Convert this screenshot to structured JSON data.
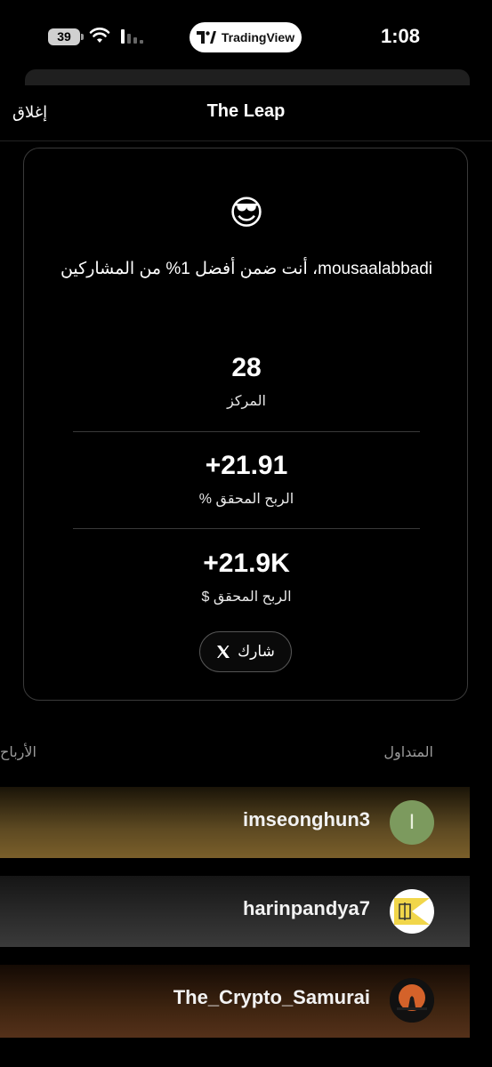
{
  "status_bar": {
    "battery": "39",
    "app_pill": "TradingView",
    "time": "1:08"
  },
  "header": {
    "close": "إغلاق",
    "title": "The Leap"
  },
  "card": {
    "emoji": "😎",
    "message": "mousaalabbadi، أنت ضمن أفضل 1% من المشاركين",
    "stats": [
      {
        "value": "28",
        "label": "المركز"
      },
      {
        "value": "+21.91",
        "label": "الربح المحقق %"
      },
      {
        "value": "+21.9K",
        "label": "الربح المحقق $"
      }
    ],
    "share_label": "شارك",
    "share_icon": "x-logo-icon"
  },
  "leaderboard": {
    "col_trader": "المتداول",
    "col_profit": "الأرباح",
    "rows": [
      {
        "name": "imseonghun3",
        "avatar_letter": "I",
        "avatar_color": "#7c9a5e"
      },
      {
        "name": "harinpandya7",
        "avatar_letter": "",
        "avatar_color": "#ffffff"
      },
      {
        "name": "The_Crypto_Samurai",
        "avatar_letter": "",
        "avatar_color": "#111111"
      }
    ]
  }
}
